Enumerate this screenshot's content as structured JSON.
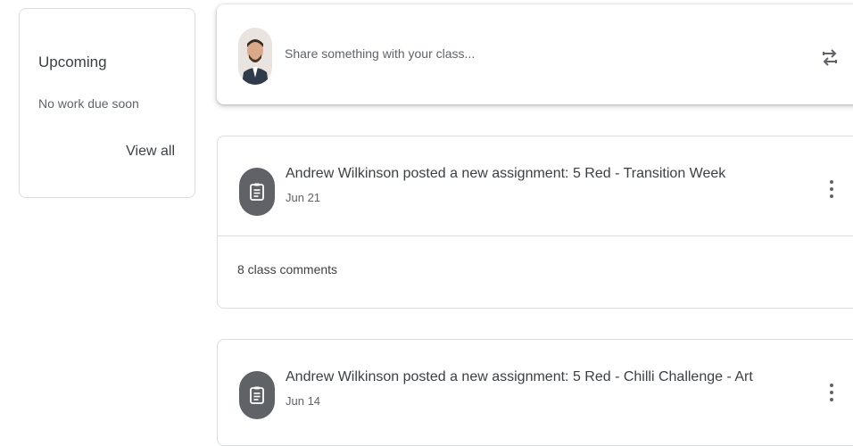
{
  "upcoming": {
    "title": "Upcoming",
    "empty_text": "No work due soon",
    "view_all": "View all"
  },
  "share": {
    "placeholder": "Share something with your class..."
  },
  "posts": [
    {
      "title": "Andrew Wilkinson posted a new assignment: 5 Red - Transition Week",
      "date": "Jun 21",
      "comments": "8 class comments"
    },
    {
      "title": "Andrew Wilkinson posted a new assignment: 5 Red - Chilli Challenge - Art",
      "date": "Jun 14"
    }
  ],
  "icons": {
    "assignment": "clipboard-icon",
    "repost": "repost-icon",
    "more": "more-vert-icon"
  },
  "colors": {
    "icon_circle": "#5f6368",
    "border": "#dadce0",
    "text": "#3c4043",
    "secondary_text": "#5f6368"
  }
}
